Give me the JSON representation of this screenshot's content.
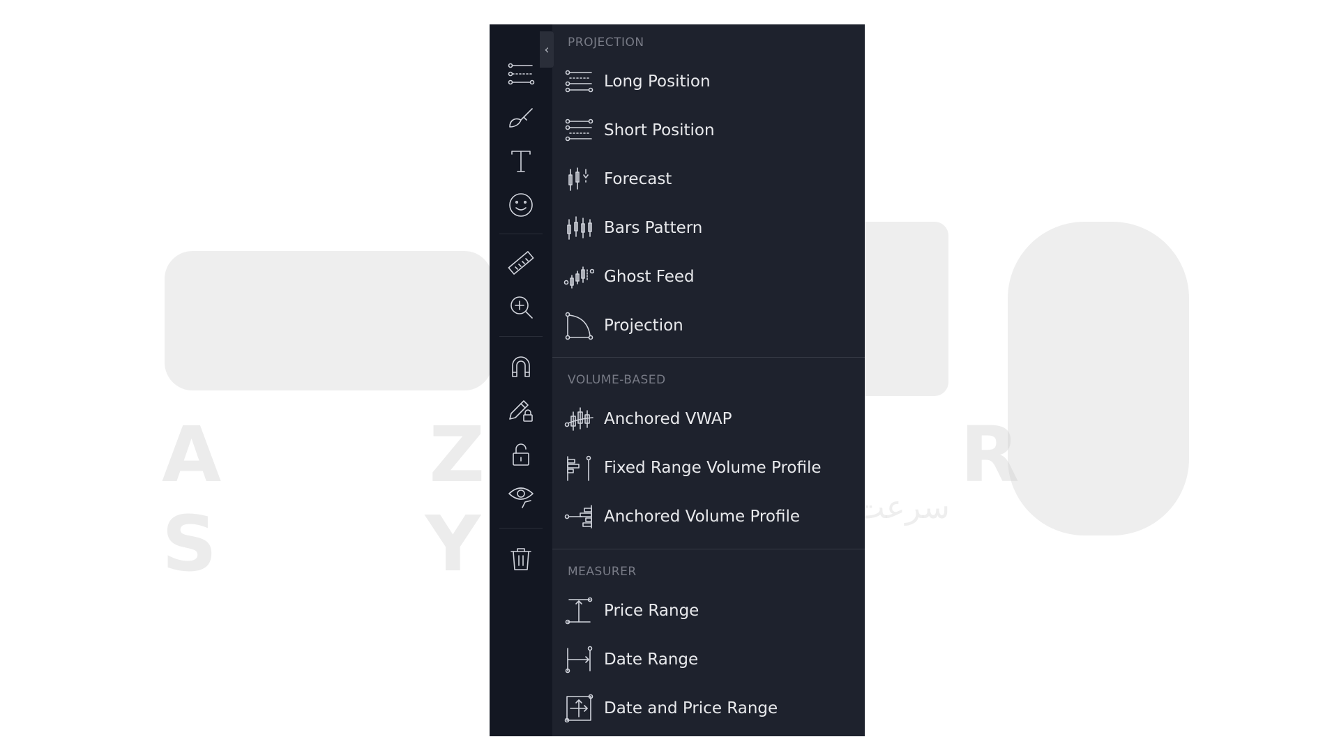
{
  "toolbar": {
    "collapse_glyph": "‹",
    "buttons": [
      {
        "icon": "trend-line-tools-icon"
      },
      {
        "icon": "brush-icon"
      },
      {
        "icon": "text-icon"
      },
      {
        "icon": "emoji-icon"
      },
      {
        "icon": "ruler-icon"
      },
      {
        "icon": "zoom-in-icon"
      },
      {
        "icon": "magnet-icon"
      },
      {
        "icon": "lock-drawing-icon"
      },
      {
        "icon": "lock-icon"
      },
      {
        "icon": "eye-icon"
      },
      {
        "icon": "trash-icon"
      }
    ]
  },
  "menu": {
    "sections": [
      {
        "title": "PROJECTION",
        "items": [
          {
            "label": "Long Position",
            "icon": "long-position-icon"
          },
          {
            "label": "Short Position",
            "icon": "short-position-icon"
          },
          {
            "label": "Forecast",
            "icon": "forecast-icon"
          },
          {
            "label": "Bars Pattern",
            "icon": "bars-pattern-icon"
          },
          {
            "label": "Ghost Feed",
            "icon": "ghost-feed-icon"
          },
          {
            "label": "Projection",
            "icon": "projection-icon"
          }
        ]
      },
      {
        "title": "VOLUME-BASED",
        "items": [
          {
            "label": "Anchored VWAP",
            "icon": "anchored-vwap-icon"
          },
          {
            "label": "Fixed Range Volume Profile",
            "icon": "fixed-range-volume-profile-icon"
          },
          {
            "label": "Anchored Volume Profile",
            "icon": "anchored-volume-profile-icon"
          }
        ]
      },
      {
        "title": "MEASURER",
        "items": [
          {
            "label": "Price Range",
            "icon": "price-range-icon"
          },
          {
            "label": "Date Range",
            "icon": "date-range-icon"
          },
          {
            "label": "Date and Price Range",
            "icon": "date-and-price-range-icon"
          }
        ]
      }
    ]
  },
  "watermark": {
    "latin": "A Z A R S Y S",
    "persian": "سرعت بی نهایت میزبانی وب"
  },
  "colors": {
    "panel_bg": "#1e222d",
    "toolbar_bg": "#131722",
    "text": "#e8e9ec",
    "section_title": "#787b86",
    "icon_stroke": "#d1d4dc"
  }
}
